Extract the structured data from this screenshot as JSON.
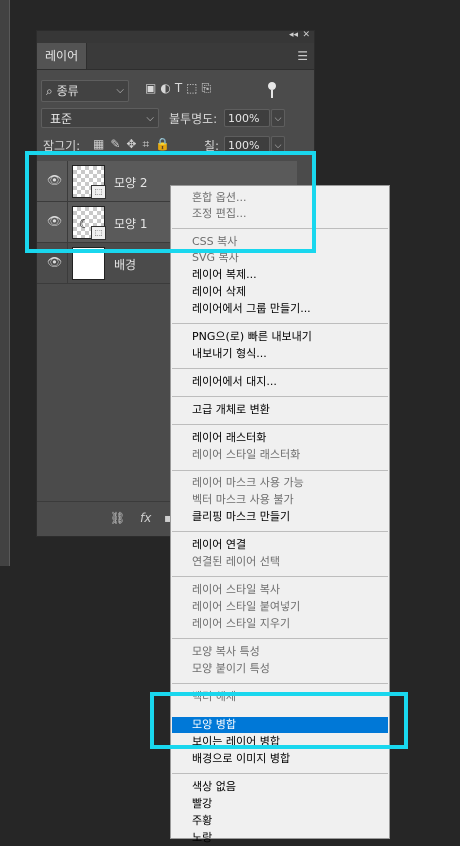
{
  "panel": {
    "title_tab": "레이어",
    "filter": {
      "kind_label": "종류"
    },
    "blend_mode": "표준",
    "opacity_label": "불투명도:",
    "opacity_value": "100%",
    "lock_label": "잠그기:",
    "fill_label": "칠:",
    "fill_value": "100%",
    "layers": [
      {
        "name": "모양 2",
        "selected": true
      },
      {
        "name": "모양 1",
        "selected": true
      },
      {
        "name": "배경",
        "selected": false
      }
    ]
  },
  "context_menu": {
    "items": [
      {
        "label": "혼합 옵션...",
        "enabled": false
      },
      {
        "label": "조정 편집...",
        "enabled": false
      },
      {
        "label": "CSS 복사",
        "enabled": false
      },
      {
        "label": "SVG 복사",
        "enabled": false
      },
      {
        "label": "레이어 복제...",
        "enabled": true
      },
      {
        "label": "레이어 삭제",
        "enabled": true
      },
      {
        "label": "레이어에서 그룹 만들기...",
        "enabled": true
      },
      {
        "label": "PNG으(로) 빠른 내보내기",
        "enabled": true
      },
      {
        "label": "내보내기 형식...",
        "enabled": true
      },
      {
        "label": "레이어에서 대지...",
        "enabled": true
      },
      {
        "label": "고급 개체로 변환",
        "enabled": true
      },
      {
        "label": "레이어 래스터화",
        "enabled": true
      },
      {
        "label": "레이어 스타일 래스터화",
        "enabled": false
      },
      {
        "label": "레이어 마스크 사용 가능",
        "enabled": false
      },
      {
        "label": "벡터 마스크 사용 불가",
        "enabled": false
      },
      {
        "label": "클리핑 마스크 만들기",
        "enabled": true
      },
      {
        "label": "레이어 연결",
        "enabled": true
      },
      {
        "label": "연결된 레이어 선택",
        "enabled": false
      },
      {
        "label": "레이어 스타일 복사",
        "enabled": false
      },
      {
        "label": "레이어 스타일 붙여넣기",
        "enabled": false
      },
      {
        "label": "레이어 스타일 지우기",
        "enabled": false
      },
      {
        "label": "모양 복사 특성",
        "enabled": false
      },
      {
        "label": "모양 붙이기 특성",
        "enabled": false
      },
      {
        "label": "벡터 해제",
        "enabled": false
      },
      {
        "label": "모양 병합",
        "enabled": true,
        "highlighted": true
      },
      {
        "label": "보이는 레이어 병합",
        "enabled": true
      },
      {
        "label": "배경으로 이미지 병합",
        "enabled": true
      },
      {
        "label": "색상 없음",
        "enabled": true
      },
      {
        "label": "빨강",
        "enabled": true
      },
      {
        "label": "주황",
        "enabled": true
      },
      {
        "label": "노랑",
        "enabled": true
      }
    ]
  },
  "colors": {
    "annotation": "#19d7ee",
    "menu_highlight": "#0078d7",
    "panel_bg": "#4b4b4b",
    "canvas_bg": "#262626"
  }
}
